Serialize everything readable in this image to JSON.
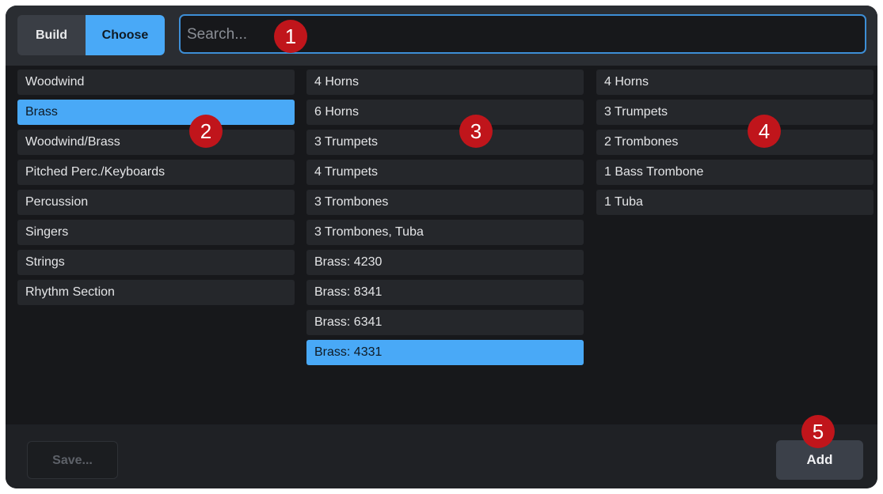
{
  "header": {
    "mode_tabs": [
      {
        "label": "Build",
        "active": false
      },
      {
        "label": "Choose",
        "active": true
      }
    ],
    "search": {
      "placeholder": "Search...",
      "value": ""
    }
  },
  "families": [
    {
      "label": "Woodwind",
      "selected": false
    },
    {
      "label": "Brass",
      "selected": true
    },
    {
      "label": "Woodwind/Brass",
      "selected": false
    },
    {
      "label": "Pitched Perc./Keyboards",
      "selected": false
    },
    {
      "label": "Percussion",
      "selected": false
    },
    {
      "label": "Singers",
      "selected": false
    },
    {
      "label": "Strings",
      "selected": false
    },
    {
      "label": "Rhythm Section",
      "selected": false
    }
  ],
  "ensembles": [
    {
      "label": "4 Horns",
      "selected": false
    },
    {
      "label": "6 Horns",
      "selected": false
    },
    {
      "label": "3 Trumpets",
      "selected": false
    },
    {
      "label": "4 Trumpets",
      "selected": false
    },
    {
      "label": "3 Trombones",
      "selected": false
    },
    {
      "label": "3 Trombones, Tuba",
      "selected": false
    },
    {
      "label": "Brass: 4230",
      "selected": false
    },
    {
      "label": "Brass: 8341",
      "selected": false
    },
    {
      "label": "Brass: 6341",
      "selected": false
    },
    {
      "label": "Brass: 4331",
      "selected": true
    }
  ],
  "contents": [
    {
      "label": "4 Horns"
    },
    {
      "label": "3 Trumpets"
    },
    {
      "label": "2 Trombones"
    },
    {
      "label": "1 Bass Trombone"
    },
    {
      "label": "1 Tuba"
    }
  ],
  "footer": {
    "save_label": "Save...",
    "add_label": "Add"
  },
  "callouts": [
    "1",
    "2",
    "3",
    "4",
    "5"
  ],
  "colors": {
    "accent": "#49a9f7",
    "callout": "#c0151b",
    "background": "#17181b"
  }
}
